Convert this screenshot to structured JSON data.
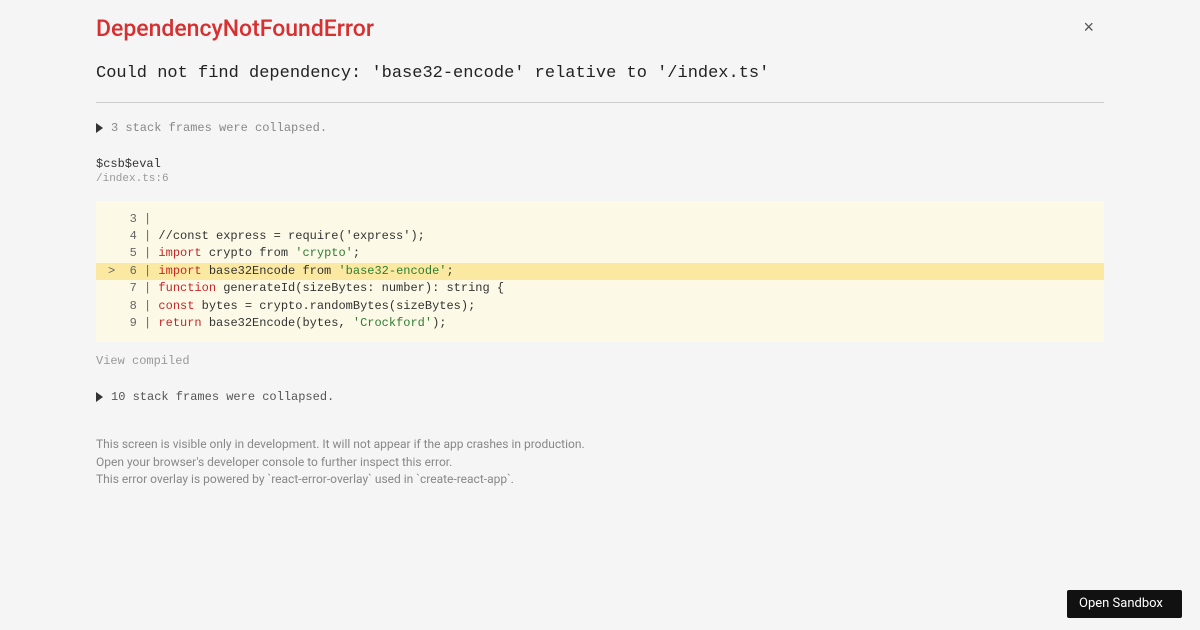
{
  "error": {
    "title": "DependencyNotFoundError",
    "message": "Could not find dependency: 'base32-encode' relative to '/index.ts'"
  },
  "collapse1": "3 stack frames were collapsed.",
  "frame": {
    "name": "$csb$eval",
    "location": "/index.ts:6"
  },
  "code": {
    "lines": [
      {
        "num": "3",
        "marker": " ",
        "segments": [
          {
            "cls": "plain",
            "text": ""
          }
        ]
      },
      {
        "num": "4",
        "marker": " ",
        "segments": [
          {
            "cls": "comment",
            "text": "//const express = require('express');"
          }
        ]
      },
      {
        "num": "5",
        "marker": " ",
        "segments": [
          {
            "cls": "kw",
            "text": "import"
          },
          {
            "cls": "plain",
            "text": " crypto from "
          },
          {
            "cls": "str",
            "text": "'crypto'"
          },
          {
            "cls": "plain",
            "text": ";"
          }
        ]
      },
      {
        "num": "6",
        "marker": ">",
        "highlight": true,
        "segments": [
          {
            "cls": "kw",
            "text": "import"
          },
          {
            "cls": "plain",
            "text": " base32Encode from "
          },
          {
            "cls": "str",
            "text": "'base32-encode'"
          },
          {
            "cls": "plain",
            "text": ";"
          }
        ]
      },
      {
        "num": "7",
        "marker": " ",
        "segments": [
          {
            "cls": "kw",
            "text": "function"
          },
          {
            "cls": "plain",
            "text": " generateId(sizeBytes: number): string {"
          }
        ]
      },
      {
        "num": "8",
        "marker": " ",
        "segments": [
          {
            "cls": "kw",
            "text": "const"
          },
          {
            "cls": "plain",
            "text": " bytes = crypto.randomBytes(sizeBytes);"
          }
        ]
      },
      {
        "num": "9",
        "marker": " ",
        "segments": [
          {
            "cls": "kw",
            "text": "return"
          },
          {
            "cls": "plain",
            "text": " base32Encode(bytes, "
          },
          {
            "cls": "str",
            "text": "'Crockford'"
          },
          {
            "cls": "plain",
            "text": ");"
          }
        ]
      }
    ]
  },
  "viewCompiled": "View compiled",
  "collapse2": "10 stack frames were collapsed.",
  "footer": {
    "line1": "This screen is visible only in development. It will not appear if the app crashes in production.",
    "line2": "Open your browser's developer console to further inspect this error.",
    "line3": "This error overlay is powered by `react-error-overlay` used in `create-react-app`."
  },
  "openSandbox": "Open Sandbox",
  "closeLabel": "×"
}
